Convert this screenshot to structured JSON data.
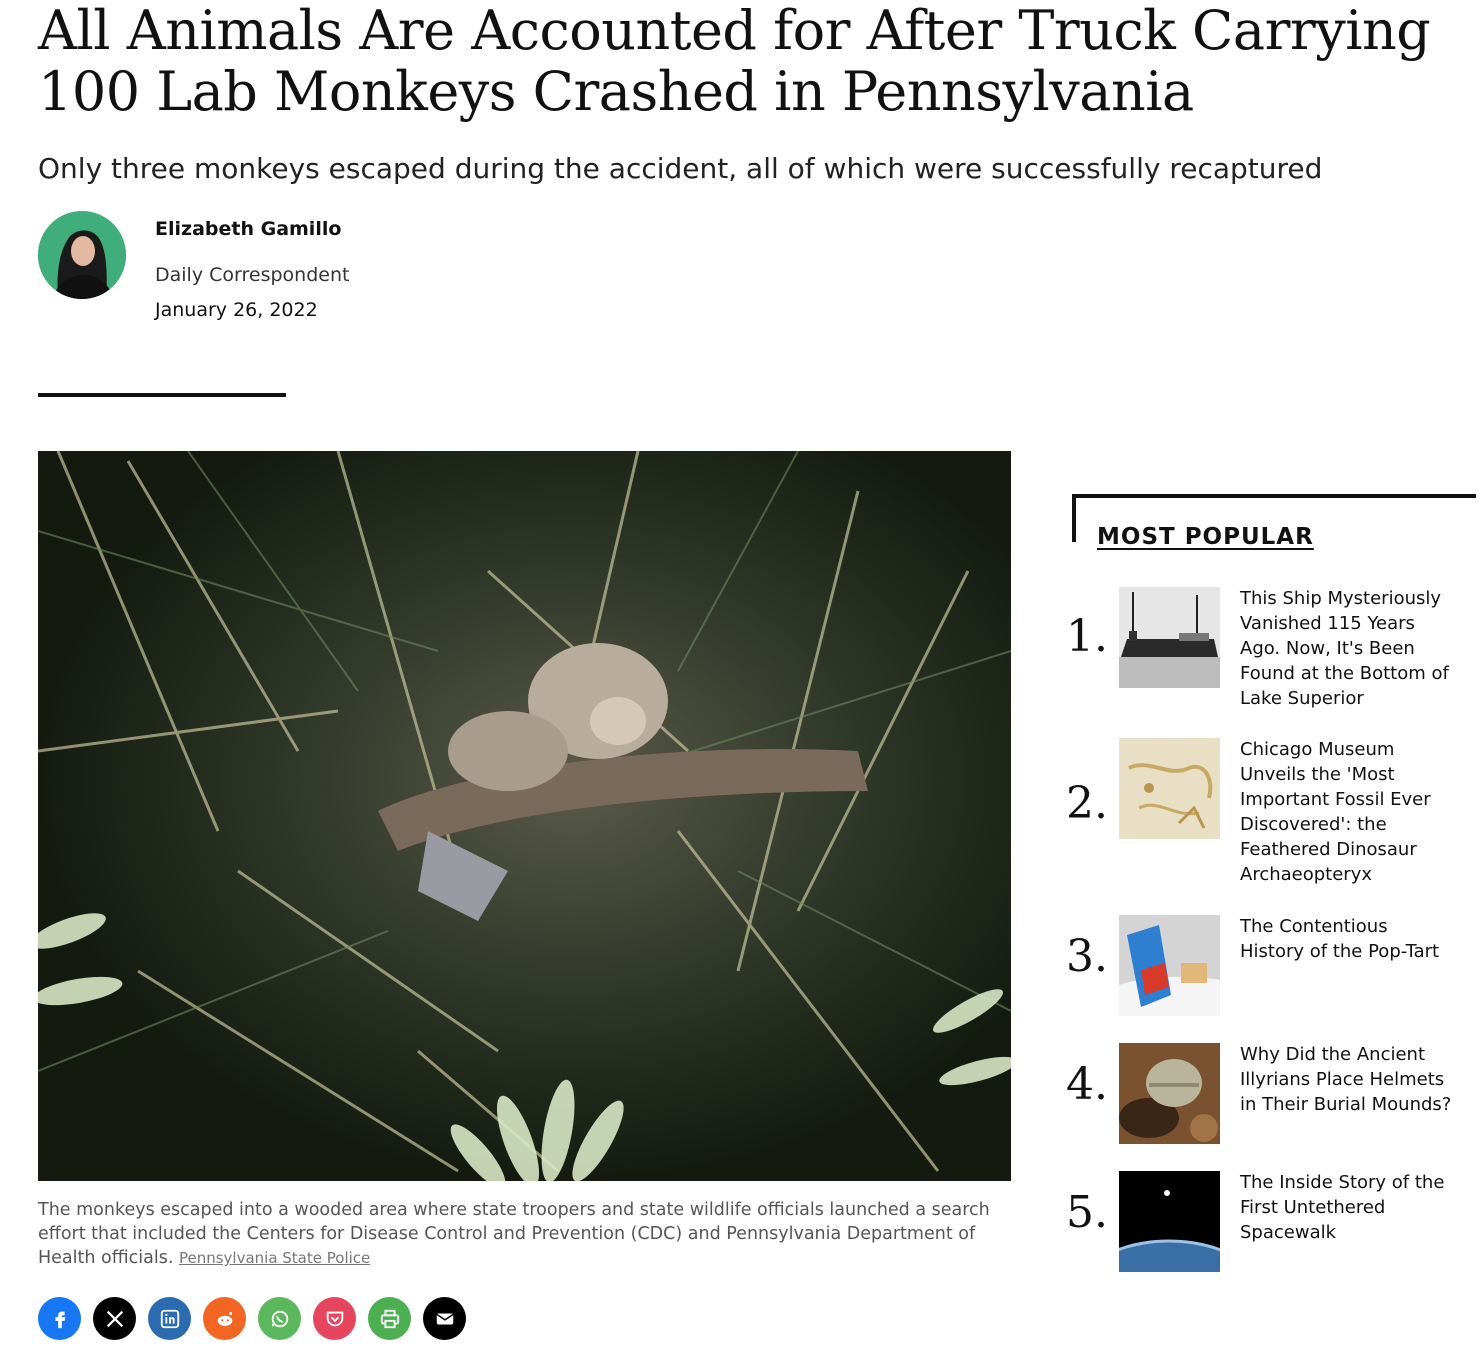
{
  "article": {
    "title": "All Animals Are Accounted for After Truck Carrying 100 Lab Monkeys Crashed in Pennsylvania",
    "dek": "Only three monkeys escaped during the accident, all of which were successfully recaptured",
    "author": "Elizabeth Gamillo",
    "role": "Daily Correspondent",
    "date": "January 26, 2022",
    "caption": "The monkeys escaped into a wooded area where state troopers and state wildlife officials launched a search effort that included the Centers for Disease Control and Prevention (CDC) and Pennsylvania Department of Health officials. ",
    "credit": "Pennsylvania State Police"
  },
  "share": [
    {
      "icon": "facebook-icon",
      "color": "#1877f2"
    },
    {
      "icon": "x-icon",
      "color": "#000000"
    },
    {
      "icon": "linkedin-icon",
      "color": "#2b6cb0"
    },
    {
      "icon": "reddit-icon",
      "color": "#f26522"
    },
    {
      "icon": "whatsapp-icon",
      "color": "#5cb85c"
    },
    {
      "icon": "pocket-icon",
      "color": "#e5455d"
    },
    {
      "icon": "print-icon",
      "color": "#4caf50"
    },
    {
      "icon": "email-icon",
      "color": "#000000"
    }
  ],
  "most_popular": {
    "heading": "MOST POPULAR",
    "items": [
      {
        "num": "1.",
        "title": "This Ship Mysteriously Vanished 115 Years Ago. Now, It's Been Found at the Bottom of Lake Superior"
      },
      {
        "num": "2.",
        "title": "Chicago Museum Unveils the 'Most Important Fossil Ever Discovered': the Feathered Dinosaur Archaeopteryx"
      },
      {
        "num": "3.",
        "title": "The Contentious History of the Pop-Tart"
      },
      {
        "num": "4.",
        "title": "Why Did the Ancient Illyrians Place Helmets in Their Burial Mounds?"
      },
      {
        "num": "5.",
        "title": "The Inside Story of the First Untethered Spacewalk"
      }
    ]
  }
}
